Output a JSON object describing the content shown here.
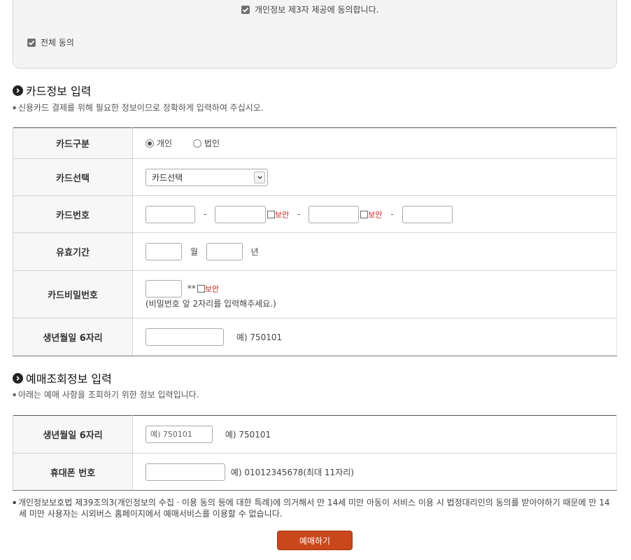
{
  "agreement": {
    "third_party": "개인정보 제3자 제공에 동의합니다.",
    "all": "전체 동의"
  },
  "card_section": {
    "title": "카드정보 입력",
    "desc": "신용카드 결제를 위해 필요한 정보이므로 정확하게 입력하여 주십시오.",
    "rows": {
      "type_label": "카드구분",
      "type_personal": "개인",
      "type_corporate": "법인",
      "select_label": "카드선택",
      "select_value": "카드선택",
      "number_label": "카드번호",
      "security": "보안",
      "dash": "-",
      "expiry_label": "유효기간",
      "month": "월",
      "year": "년",
      "password_label": "카드비밀번호",
      "password_mask": "**",
      "password_note": "(비밀번호 앞 2자리를 입력해주세요.)",
      "birth_label": "생년월일 6자리",
      "birth_example": "예) 750101"
    }
  },
  "lookup_section": {
    "title": "예매조회정보 입력",
    "desc": "아래는 예매 사항을 조회하기 위한 정보 입력입니다.",
    "rows": {
      "birth_label": "생년월일 6자리",
      "birth_placeholder": "예) 750101",
      "birth_example": "예) 750101",
      "phone_label": "휴대폰 번호",
      "phone_example": "예) 01012345678(최대 11자리)"
    }
  },
  "footnote": "개인정보보호법 제39조의3(개인정보의 수집ㆍ이용 동의 등에 대한 특례)에 의거해서 만 14세 미만 아동이 서비스 이용 시 법정대리인의 동의를 받아야하기 때문에 만 14세 미만 사용자는 시외버스 홈페이지에서 예매서비스를 이용할 수 없습니다.",
  "submit_label": "예매하기",
  "colors": {
    "accent": "#c9471a",
    "security_text": "#c52222"
  },
  "icons": {
    "checkbox": "checkmark-icon",
    "bullet": "chevron-right-circle-icon",
    "select": "chevron-down-icon"
  }
}
